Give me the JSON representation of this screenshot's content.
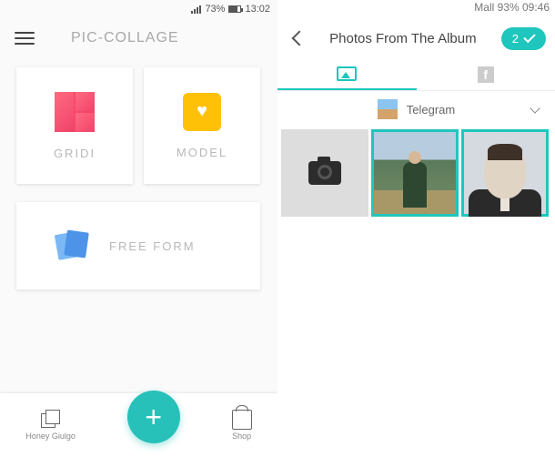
{
  "left": {
    "status": {
      "battery_text": "73%",
      "time": "13:02",
      "battery_fill_pct": 73
    },
    "app_title": "PIC-COLLAGE",
    "cards": {
      "grid_label": "GRIDI",
      "model_label": "MODEL",
      "freeform_label": "FREE FORM"
    },
    "bottom": {
      "home_label": "Honey Giulgo",
      "fab_glyph": "+",
      "shop_label": "Shop"
    }
  },
  "right": {
    "status_text": "Mall 93% 09:46",
    "header": {
      "title": "Photos From The Album",
      "selected_count": "2"
    },
    "tabs": {
      "gallery_active": true,
      "fb_glyph": "f"
    },
    "album": {
      "name": "Telegram"
    },
    "photos": {
      "camera": {
        "selected": false
      },
      "items": [
        {
          "selected": true,
          "name": "landscape-person"
        },
        {
          "selected": true,
          "name": "portrait-man"
        }
      ]
    },
    "colors": {
      "accent": "#1fc6bd"
    }
  }
}
